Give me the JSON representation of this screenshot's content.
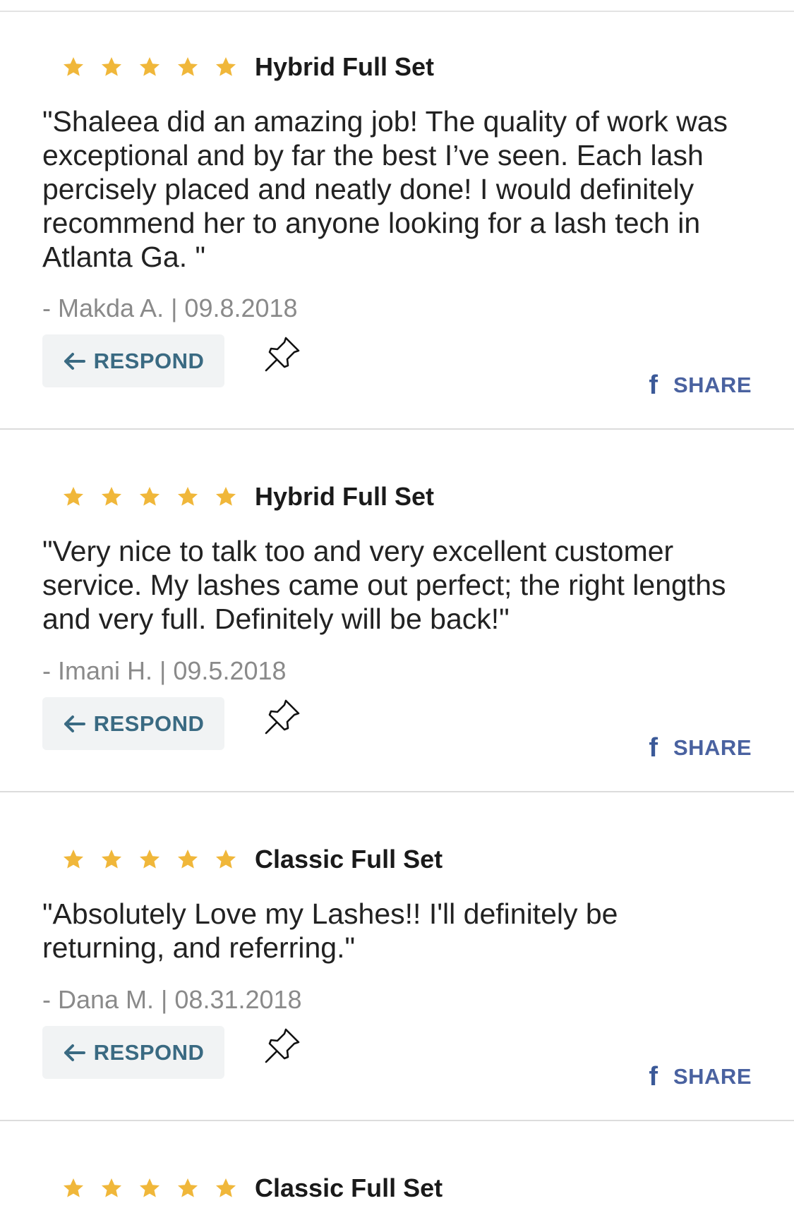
{
  "colors": {
    "star": "#f0b73a",
    "respond_text": "#3a6a82",
    "share_text": "#4a62a0",
    "facebook": "#3b5998"
  },
  "icons": {
    "star": "star-icon",
    "respond": "reply-arrow-icon",
    "pin": "pushpin-icon",
    "share": "facebook-icon"
  },
  "actions": {
    "respond_label": "RESPOND",
    "share_label": "SHARE"
  },
  "reviews": [
    {
      "rating": 5,
      "service": "Hybrid Full Set",
      "text": "\"Shaleea did an amazing job! The quality of work was exceptional and by far the best I’ve seen. Each lash percisely placed and neatly done! I would definitely recommend her to anyone looking for a lash tech in Atlanta Ga. \"",
      "byline": "- Makda A. | 09.8.2018"
    },
    {
      "rating": 5,
      "service": "Hybrid Full Set",
      "text": "\"Very nice to talk too and very excellent customer service. My lashes came out perfect; the right lengths and very full. Definitely will be back!\"",
      "byline": "- Imani H. | 09.5.2018"
    },
    {
      "rating": 5,
      "service": "Classic Full Set",
      "text": "\"Absolutely Love my Lashes!! I'll definitely be returning, and referring.\"",
      "byline": "- Dana M. | 08.31.2018"
    },
    {
      "rating": 5,
      "service": "Classic Full Set"
    }
  ]
}
